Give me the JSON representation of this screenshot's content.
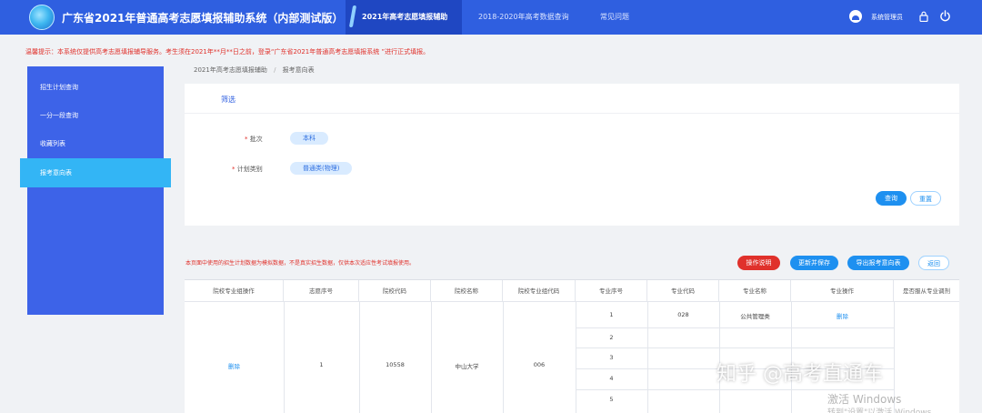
{
  "header": {
    "title": "广东省2021年普通高考志愿填报辅助系统（内部测试版）",
    "tabs": [
      {
        "label": "2021年高考志愿填报辅助",
        "active": true
      },
      {
        "label": "2018-2020年高考数据查询",
        "active": false
      },
      {
        "label": "常见问题",
        "active": false
      }
    ],
    "user_label": "系统管理员"
  },
  "notice": "温馨提示：本系统仅提供高考志愿填报辅导服务。考生须在2021年**月**日之前，登录“广东省2021年普通高考志愿填报系统 ”进行正式填报。",
  "sidebar": {
    "items": [
      {
        "label": "招生计划查询",
        "active": false
      },
      {
        "label": "一分一段查询",
        "active": false
      },
      {
        "label": "收藏列表",
        "active": false
      },
      {
        "label": "报考意向表",
        "active": true
      }
    ]
  },
  "breadcrumb": {
    "root": "2021年高考志愿填报辅助",
    "sep": "/",
    "current": "报考意向表"
  },
  "filter": {
    "title": "筛选",
    "batch_label": "批次",
    "batch_value": "本科",
    "plan_label": "计划类别",
    "plan_value": "普通类(物理)",
    "query_button": "查询",
    "reset_button": "重置"
  },
  "data_note": "本页面中使用的招生计划数据为模拟数据，不是真实招生数据，仅供本次适应性考试填报使用。",
  "actions": {
    "help": "操作说明",
    "update_save": "更新并保存",
    "export": "导出报考意向表",
    "back": "返回"
  },
  "table": {
    "headers": [
      "院校专业组操作",
      "志愿序号",
      "院校代码",
      "院校名称",
      "院校专业组代码",
      "专业序号",
      "专业代码",
      "专业名称",
      "专业操作",
      "是否服从专业调剂"
    ],
    "group": {
      "op": "删除",
      "seq": "1",
      "school_code": "10558",
      "school_name": "中山大学",
      "group_code": "006"
    },
    "rows": [
      {
        "seq": "1",
        "major_code": "028",
        "major_name": "公共管理类",
        "op": "删除"
      },
      {
        "seq": "2",
        "major_code": "",
        "major_name": "",
        "op": ""
      },
      {
        "seq": "3",
        "major_code": "",
        "major_name": "",
        "op": ""
      },
      {
        "seq": "4",
        "major_code": "",
        "major_name": "",
        "op": ""
      },
      {
        "seq": "5",
        "major_code": "",
        "major_name": "",
        "op": ""
      }
    ]
  },
  "watermarks": {
    "zhihu": "知乎 @高考直通车",
    "windows_line1": "激活 Windows",
    "windows_line2": "转到\"设置\"以激活 Windows。"
  },
  "colors": {
    "header_bg": "#2f5fe0",
    "sidebar_bg": "#3d63e8",
    "sidebar_active": "#33b5f5",
    "primary": "#1e90f0",
    "danger": "#e0312b"
  }
}
